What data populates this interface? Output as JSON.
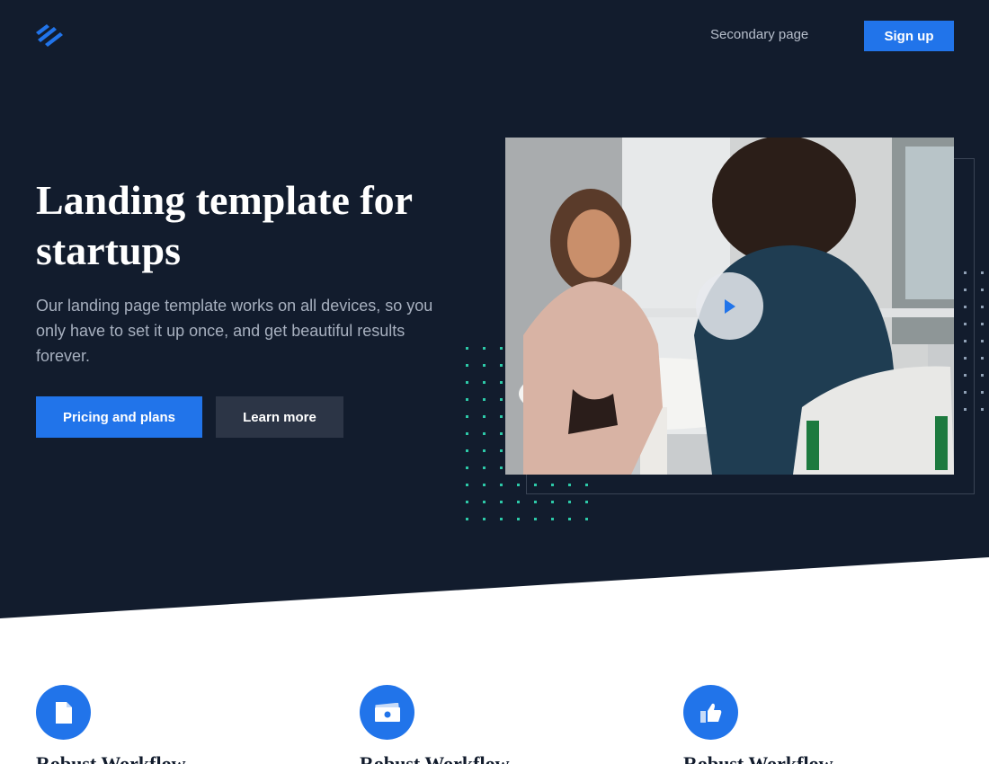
{
  "header": {
    "logo_icon": "stripes-logo-icon",
    "nav_link": "Secondary page",
    "signup_label": "Sign up"
  },
  "hero": {
    "title": "Landing template for startups",
    "subtitle": "Our landing page template works on all devices, so you only have to set it up once, and get beautiful results forever.",
    "primary_button": "Pricing and plans",
    "secondary_button": "Learn more",
    "video_play_icon": "play-icon"
  },
  "features": [
    {
      "icon": "document-icon",
      "title": "Robust Workflow"
    },
    {
      "icon": "money-icon",
      "title": "Robust Workflow"
    },
    {
      "icon": "thumbs-up-icon",
      "title": "Robust Workflow"
    }
  ],
  "colors": {
    "hero_bg": "#121c2d",
    "accent": "#2174ea",
    "dark_button": "#2c3546",
    "dots": "#2dc9a8"
  }
}
